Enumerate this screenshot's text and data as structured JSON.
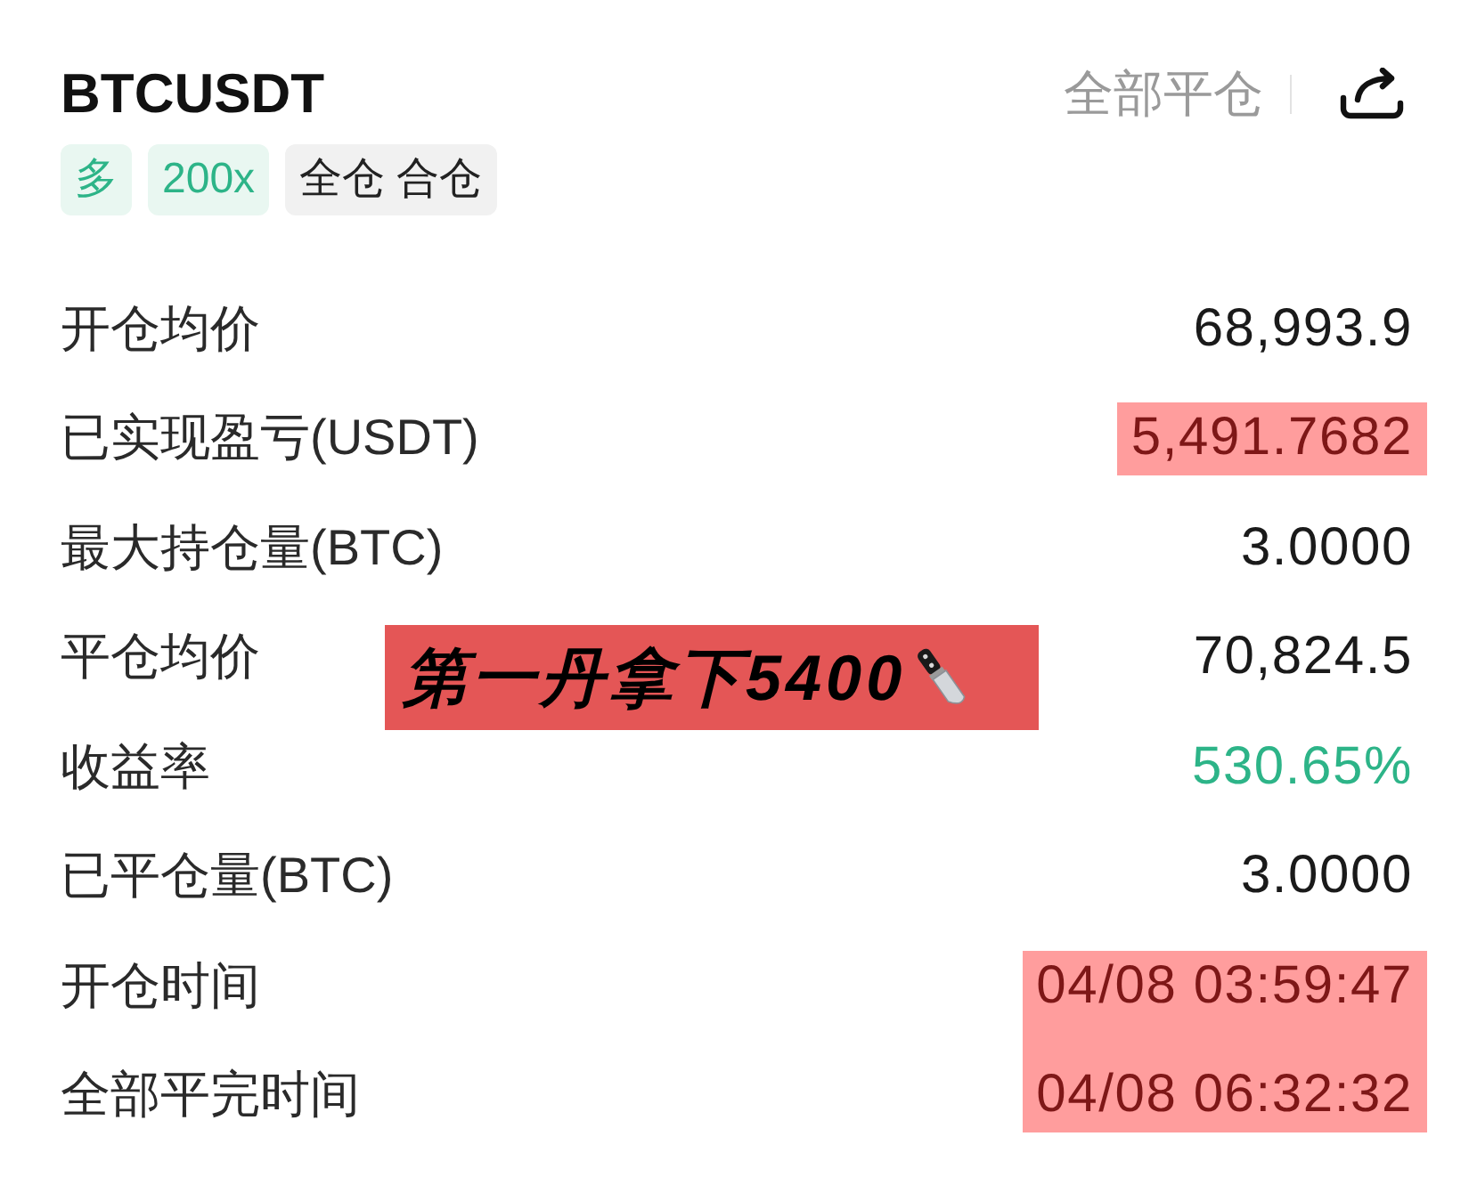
{
  "header": {
    "symbol": "BTCUSDT",
    "close_all": "全部平仓"
  },
  "tags": [
    {
      "label": "多",
      "kind": "accent"
    },
    {
      "label": "200x",
      "kind": "accent"
    },
    {
      "label": "全仓 合仓",
      "kind": "neutral"
    }
  ],
  "details": [
    {
      "label": "开仓均价",
      "value": "68,993.9",
      "kind": "plain",
      "highlighted": false
    },
    {
      "label": "已实现盈亏(USDT)",
      "value": "5,491.7682",
      "kind": "plain",
      "highlighted": true
    },
    {
      "label": "最大持仓量(BTC)",
      "value": "3.0000",
      "kind": "plain",
      "highlighted": false
    },
    {
      "label": "平仓均价",
      "value": "70,824.5",
      "kind": "plain",
      "highlighted": false
    },
    {
      "label": "收益率",
      "value": "530.65%",
      "kind": "profit",
      "highlighted": false
    },
    {
      "label": "已平仓量(BTC)",
      "value": "3.0000",
      "kind": "plain",
      "highlighted": false
    },
    {
      "label": "开仓时间",
      "value": "04/08 03:59:47",
      "kind": "plain",
      "highlighted": true
    },
    {
      "label": "全部平完时间",
      "value": "04/08 06:32:32",
      "kind": "plain",
      "highlighted": true
    }
  ],
  "banner": {
    "text": "第一丹拿下5400"
  }
}
